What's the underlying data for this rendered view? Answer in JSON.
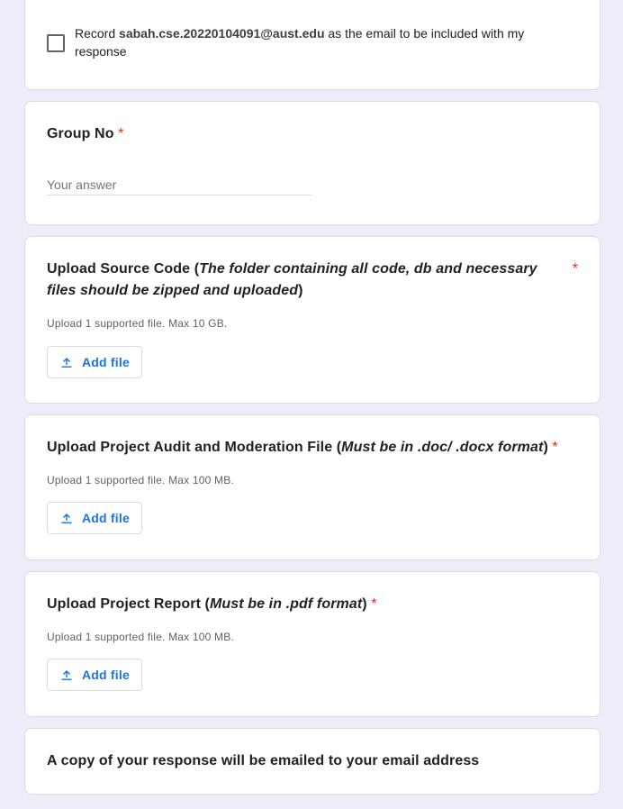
{
  "email_record": {
    "prefix": "Record ",
    "email": "sabah.cse.20220104091@aust.edu",
    "suffix": " as the email to be included with my response"
  },
  "questions": [
    {
      "title_plain": "Group No",
      "required_mark": "*",
      "placeholder": "Your answer",
      "value": ""
    },
    {
      "title_plain": "Upload Source Code (",
      "title_italic": "The folder containing all code, db and necessary files should be zipped and uploaded",
      "title_end": ")",
      "required_mark": "*",
      "hint": "Upload 1 supported file. Max 10 GB.",
      "button_label": "Add file"
    },
    {
      "title_plain": "Upload Project Audit and Moderation File (",
      "title_italic": "Must be in .doc/ .docx format",
      "title_end": ")",
      "required_mark": "*",
      "hint": "Upload 1 supported file. Max 100 MB.",
      "button_label": "Add file"
    },
    {
      "title_plain": "Upload Project Report (",
      "title_italic": "Must be in .pdf format",
      "title_end": ")",
      "required_mark": "*",
      "hint": "Upload 1 supported file. Max 100 MB.",
      "button_label": "Add file"
    }
  ],
  "footer_notice": "A copy of your response will be emailed to your email address",
  "icons": {
    "upload": "upload-icon"
  },
  "colors": {
    "background": "#f0ebf8",
    "accent": "#1a73e8",
    "required": "#d93025"
  }
}
